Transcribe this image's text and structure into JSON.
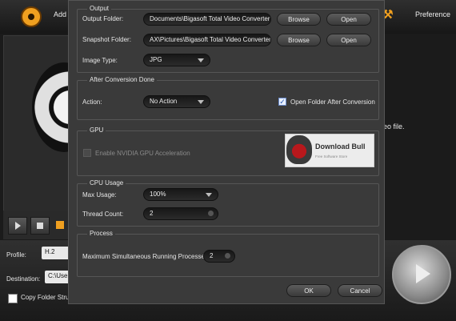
{
  "app": {
    "add_label": "Add",
    "preference_label": "Preference",
    "right_text": "eo file.",
    "profile_label": "Profile:",
    "profile_value": "H.2",
    "destination_label": "Destination:",
    "destination_value": "C:\\User",
    "copy_folder_label": "Copy Folder Struc"
  },
  "dialog": {
    "output": {
      "title": "Output",
      "output_folder_label": "Output Folder:",
      "output_folder_value": "Documents\\Bigasoft Total Video Converter",
      "snapshot_folder_label": "Snapshot Folder:",
      "snapshot_folder_value": "AX\\Pictures\\Bigasoft Total Video Converter",
      "browse_label": "Browse",
      "open_label": "Open",
      "image_type_label": "Image Type:",
      "image_type_value": "JPG"
    },
    "after_conversion": {
      "title": "After Conversion Done",
      "action_label": "Action:",
      "action_value": "No Action",
      "open_folder_label": "Open Folder After Conversion",
      "open_folder_checked": true
    },
    "gpu": {
      "title": "GPU",
      "enable_label": "Enable NVIDIA GPU Acceleration",
      "enabled": false
    },
    "cpu": {
      "title": "CPU Usage",
      "max_usage_label": "Max Usage:",
      "max_usage_value": "100%",
      "thread_count_label": "Thread Count:",
      "thread_count_value": "2"
    },
    "process": {
      "title": "Process",
      "max_processes_label": "Maximum Simultaneous Running Processes:",
      "max_processes_value": "2"
    },
    "ok_label": "OK",
    "cancel_label": "Cancel"
  },
  "watermark": {
    "title": "Download Bull",
    "subtitle": "Free Software Store"
  }
}
